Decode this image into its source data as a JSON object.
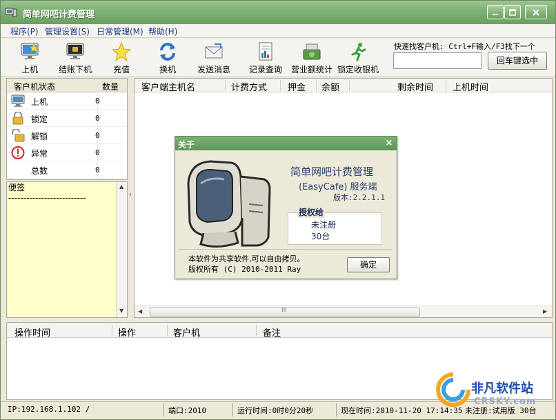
{
  "window": {
    "title": "简单网吧计费管理",
    "controls": [
      "0",
      "1",
      "r"
    ]
  },
  "menu": [
    {
      "label": "程序(P)"
    },
    {
      "label": "管理设置(S)"
    },
    {
      "label": "日常管理(M)"
    },
    {
      "label": "帮助(H)"
    }
  ],
  "toolbar": {
    "items": [
      {
        "label": "上机",
        "icon": "monitor-on-icon"
      },
      {
        "label": "结账下机",
        "icon": "monitor-off-icon"
      },
      {
        "label": "充值",
        "icon": "star-icon"
      },
      {
        "label": "换机",
        "icon": "refresh-icon"
      },
      {
        "label": "发送消息",
        "icon": "envelope-icon"
      },
      {
        "label": "记录查询",
        "icon": "report-icon"
      },
      {
        "label": "营业额统计",
        "icon": "money-icon"
      },
      {
        "label": "锁定收银机",
        "icon": "runner-icon"
      }
    ],
    "quick_search": {
      "label": "快速找客户机: Ctrl+F输入/F3找下一个",
      "value": "",
      "button": "回车键选中"
    }
  },
  "status_panel": {
    "headers": [
      "客户机状态",
      "数量"
    ],
    "rows": [
      {
        "label": "上机",
        "count": "0",
        "icon": "monitor-icon"
      },
      {
        "label": "锁定",
        "count": "0",
        "icon": "lock-icon"
      },
      {
        "label": "解锁",
        "count": "0",
        "icon": "unlock-icon"
      },
      {
        "label": "异常",
        "count": "0",
        "icon": "warning-icon"
      },
      {
        "label": "总数",
        "count": "0",
        "icon": ""
      }
    ]
  },
  "memo": {
    "title": "便签",
    "text": "--------------------------"
  },
  "client_grid": {
    "columns": [
      "客户端主机名",
      "计费方式",
      "押金",
      "余额",
      "剩余时间",
      "上机时间"
    ]
  },
  "log_grid": {
    "columns": [
      "操作时间",
      "操作",
      "客户机",
      "备注"
    ]
  },
  "statusbar": {
    "ip": "IP:192.168.1.102 /",
    "port": "端口:2010",
    "uptime": "运行时间:0时0分20秒",
    "now": "现在时间:2010-11-20 17:14:35",
    "license": "未注册:试用版 30台"
  },
  "about": {
    "title": "关于",
    "close": "×",
    "name": "简单网吧计费管理",
    "edition": "(EasyCafe) 服务端",
    "version": "版本:2.2.1.1",
    "license_label": "授权给",
    "license_status": "未注册",
    "license_seats": "30台",
    "notice": "本软件为共享软件,可以自由拷贝。",
    "copyright": "版权所有 (C) 2010-2011 Ray",
    "ok": "确定"
  },
  "watermark": {
    "cn": "非凡软件站",
    "en": "CRSKY.com"
  },
  "colors": {
    "titlebar": "#7fb276",
    "memo_bg": "#ffffc8",
    "menu_text": "#1c3a8c"
  }
}
